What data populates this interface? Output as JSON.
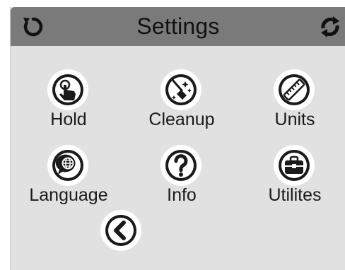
{
  "header": {
    "title": "Settings",
    "left_icon": "refresh-icon",
    "right_icon": "sync-icon"
  },
  "grid": [
    {
      "label": "Hold",
      "icon": "hand-touch-icon"
    },
    {
      "label": "Cleanup",
      "icon": "broom-icon"
    },
    {
      "label": "Units",
      "icon": "ruler-icon"
    },
    {
      "label": "Language",
      "icon": "globe-speech-icon"
    },
    {
      "label": "Info",
      "icon": "question-icon"
    },
    {
      "label": "Utilites",
      "icon": "toolbox-icon"
    }
  ],
  "back": {
    "icon": "back-chevron-icon"
  },
  "colors": {
    "header": "#7a7a7a",
    "background": "#e1e1e1",
    "icon": "#1a1a1a",
    "circle": "#ffffff"
  }
}
